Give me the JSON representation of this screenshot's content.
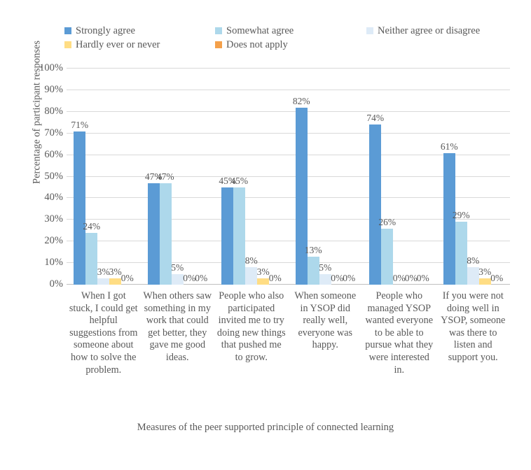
{
  "chart_data": {
    "type": "bar",
    "title": "",
    "xlabel": "Measures of the peer supported principle of connected learning",
    "ylabel": "Percentage of participant responses",
    "ylim": [
      0,
      100
    ],
    "ytick_labels": [
      "100%",
      "90%",
      "80%",
      "70%",
      "60%",
      "50%",
      "40%",
      "30%",
      "20%",
      "10%",
      "0%"
    ],
    "grid": true,
    "legend_position": "top",
    "value_labels": true,
    "categories": [
      "When I got stuck, I could get helpful suggestions from someone about how to solve the problem.",
      "When others saw something in my work that could get better, they gave me good ideas.",
      "People who also participated invited me to try doing new things that pushed me to grow.",
      "When someone in YSOP did really well, everyone was happy.",
      "People who managed YSOP wanted everyone to be able to pursue what they were interested in.",
      "If you were not doing well in YSOP, someone was there to listen and support you."
    ],
    "series": [
      {
        "name": "Strongly agree",
        "color": "#5B9BD5",
        "values": [
          71,
          47,
          45,
          82,
          74,
          61
        ],
        "labels": [
          "71%",
          "47%",
          "45%",
          "82%",
          "74%",
          "61%"
        ]
      },
      {
        "name": "Somewhat agree",
        "color": "#ADD8EB",
        "values": [
          24,
          47,
          45,
          13,
          26,
          29
        ],
        "labels": [
          "24%",
          "47%",
          "45%",
          "13%",
          "26%",
          "29%"
        ]
      },
      {
        "name": "Neither agree or disagree",
        "color": "#DEEBF7",
        "values": [
          3,
          5,
          8,
          5,
          0,
          8
        ],
        "labels": [
          "3%",
          "5%",
          "8%",
          "5%",
          "0%",
          "8%"
        ]
      },
      {
        "name": "Hardly ever or never",
        "color": "#FFDD84",
        "values": [
          3,
          0,
          3,
          0,
          0,
          3
        ],
        "labels": [
          "3%",
          "0%",
          "3%",
          "0%",
          "0%",
          "3%"
        ]
      },
      {
        "name": "Does not apply",
        "color": "#F4A04A",
        "values": [
          0,
          0,
          0,
          0,
          0,
          0
        ],
        "labels": [
          "0%",
          "0%",
          "0%",
          "0%",
          "0%",
          "0%"
        ]
      }
    ]
  }
}
